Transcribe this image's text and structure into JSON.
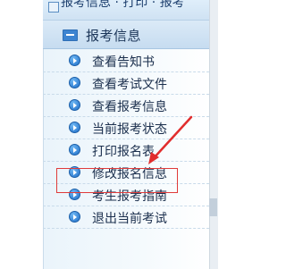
{
  "top_strip": {
    "partial_text": "报考信息 · 打印 · 报考"
  },
  "section": {
    "title": "报考信息",
    "collapse_icon": "minus-square-icon"
  },
  "menu_items": [
    {
      "label": "查看告知书",
      "icon": "arrow-circle-right-icon"
    },
    {
      "label": "查看考试文件",
      "icon": "arrow-circle-right-icon"
    },
    {
      "label": "查看报考信息",
      "icon": "arrow-circle-right-icon"
    },
    {
      "label": "当前报考状态",
      "icon": "arrow-circle-right-icon"
    },
    {
      "label": "打印报名表",
      "icon": "arrow-circle-right-icon"
    },
    {
      "label": "修改报名信息",
      "icon": "arrow-circle-right-icon"
    },
    {
      "label": "考生报考指南",
      "icon": "arrow-circle-right-icon"
    },
    {
      "label": "退出当前考试",
      "icon": "arrow-circle-right-icon"
    }
  ],
  "colors": {
    "accent": "#1f6fc9",
    "highlight_border": "#e03b3b",
    "annotation_arrow": "#e12d2d",
    "header_bg": "#c6dcf0"
  }
}
